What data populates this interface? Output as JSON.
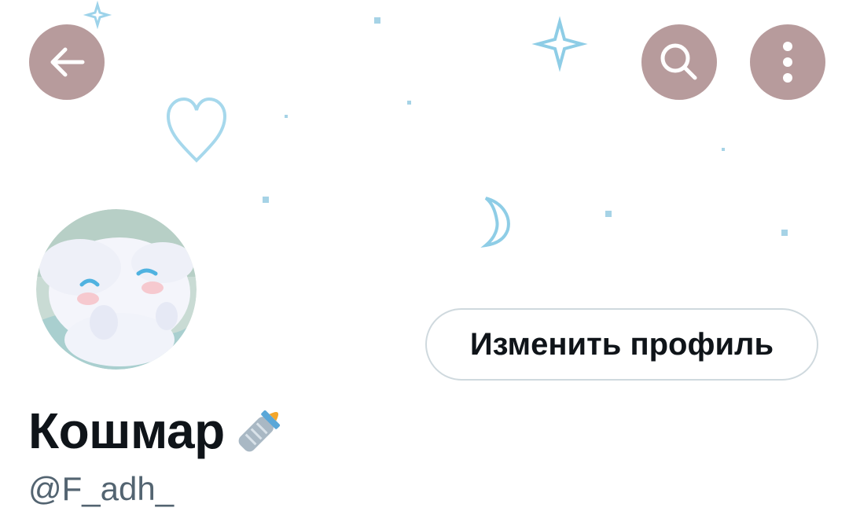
{
  "header": {
    "back_icon": "arrow-left-icon",
    "search_icon": "search-icon",
    "more_icon": "more-vertical-icon",
    "button_color": "#b79b9c"
  },
  "banner": {
    "decorations": [
      "sparkle-icon",
      "heart-outline-icon",
      "crescent-moon-icon",
      "star-dot-icon"
    ],
    "accent_color": "#8ecde6"
  },
  "profile": {
    "avatar": "cinnamoroll-avatar",
    "edit_button_label": "Изменить профиль",
    "display_name": "Кошмар",
    "name_emoji": "baby-bottle-icon",
    "handle": "@F_adh_"
  }
}
